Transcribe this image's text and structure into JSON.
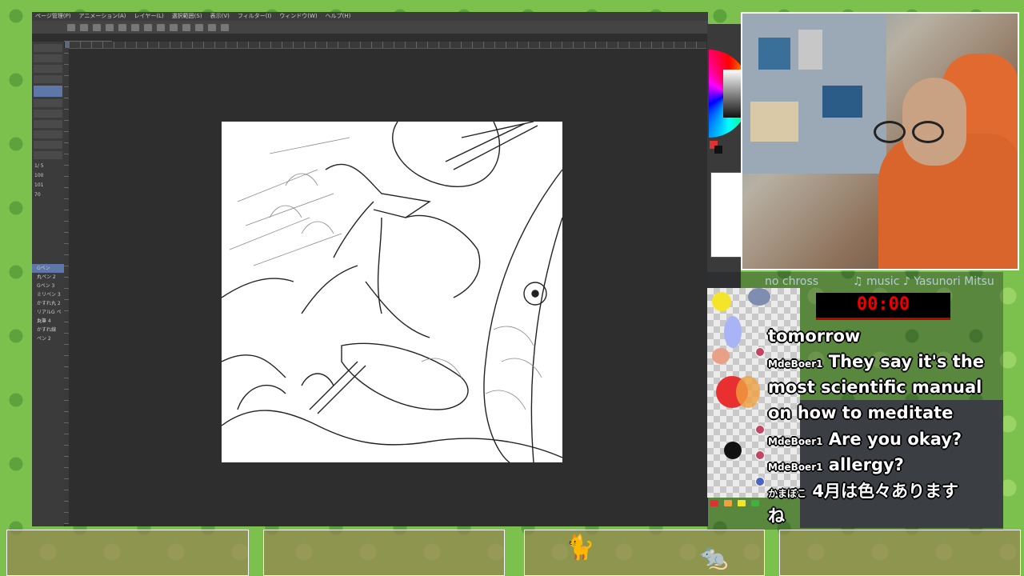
{
  "app": {
    "menu": [
      "ページ管理(P)",
      "アニメーション(A)",
      "レイヤー(L)",
      "選択範囲(S)",
      "表示(V)",
      "フィルター(I)",
      "ウィンドウ(W)",
      "ヘルプ(H)"
    ],
    "document_tab": "260418",
    "brushes": [
      "Gペン",
      "丸ペン 2",
      "Gペン 3",
      "ミリペン 3",
      "かすれ丸 2",
      "リアルG ペン",
      "丸筆 4",
      "かすれ線",
      "ペン 2"
    ],
    "properties": [
      "1/ 5",
      "100",
      "101",
      "70"
    ]
  },
  "overlay": {
    "top_left_text": "no chross",
    "music_text": "♫ music ♪ Yasunori Mitsu",
    "timer": "00:00"
  },
  "chat": {
    "messages": [
      {
        "user": "",
        "text": "tomorrow"
      },
      {
        "user": "MdeBoer1",
        "text": "They say it's the"
      },
      {
        "user": "",
        "text": "most scientific manual"
      },
      {
        "user": "",
        "text": "on how to meditate"
      },
      {
        "user": "MdeBoer1",
        "text": "Are you okay?"
      },
      {
        "user": "MdeBoer1",
        "text": "allergy?"
      },
      {
        "user": "かまぼこ",
        "text": "4月は色々あります"
      },
      {
        "user": "",
        "text": "ね"
      }
    ]
  },
  "colors": {
    "accent": "#5e76a8",
    "timer_red": "#e00000",
    "swatches": [
      "#f5e52a",
      "#8a8ff0",
      "#f0a040",
      "#e03030",
      "#40b040",
      "#202020"
    ]
  }
}
